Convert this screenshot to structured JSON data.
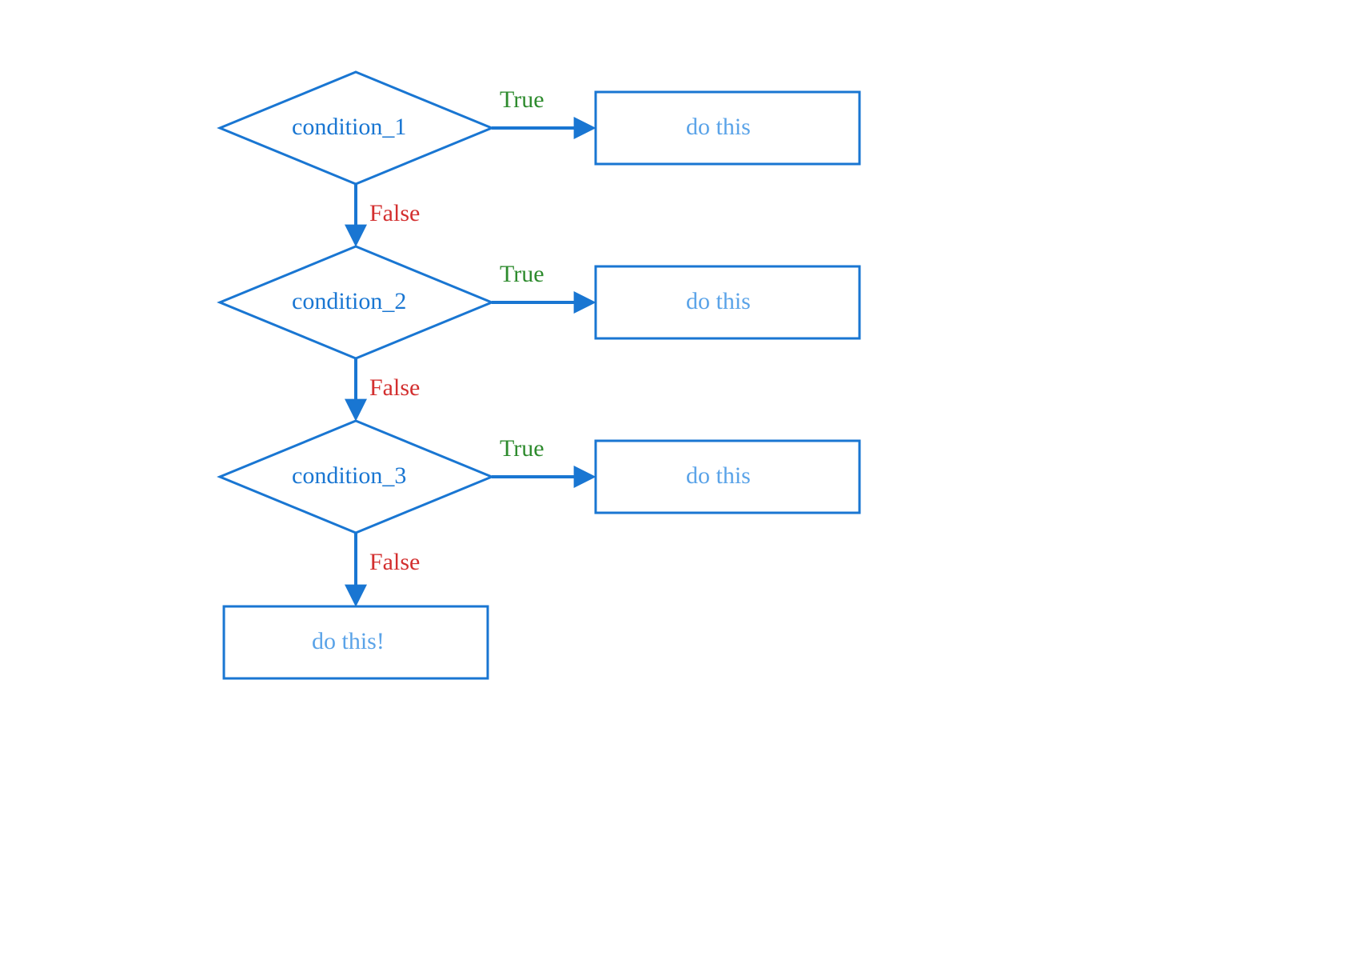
{
  "diagram": {
    "type": "flowchart",
    "description": "if/elif/else conditional flow",
    "conditions": [
      {
        "label": "condition_1",
        "true_label": "True",
        "true_action": "do this",
        "false_label": "False"
      },
      {
        "label": "condition_2",
        "true_label": "True",
        "true_action": "do this",
        "false_label": "False"
      },
      {
        "label": "condition_3",
        "true_label": "True",
        "true_action": "do this",
        "false_label": "False"
      }
    ],
    "else_action": "do this!",
    "colors": {
      "stroke": "#1976d2",
      "condition_text": "#1976d2",
      "action_text": "#5aa3e8",
      "true_text": "#2e8b2e",
      "false_text": "#d32f2f"
    }
  }
}
